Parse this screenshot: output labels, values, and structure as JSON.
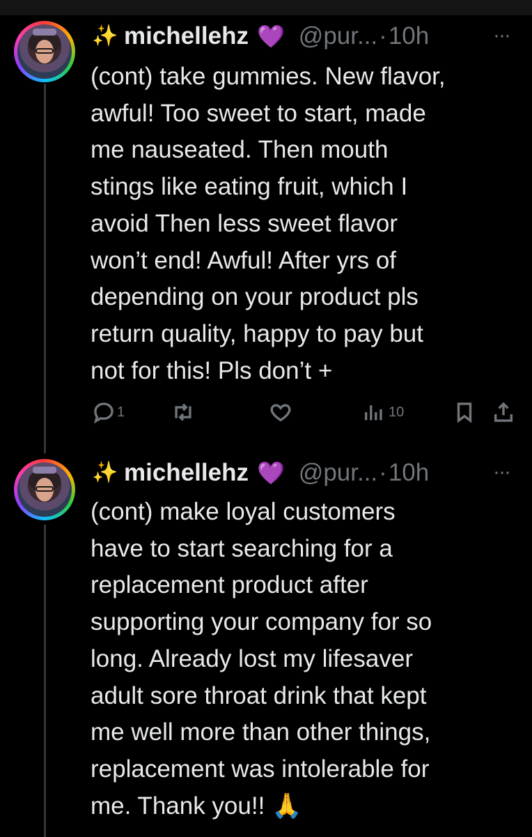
{
  "tweets": [
    {
      "emoji": "✨",
      "display_name": "michellehz",
      "heart": "💜",
      "handle": "@pur...",
      "separator": "·",
      "time": "10h",
      "more": "···",
      "text": "(cont) take gummies. New flavor,\nawful! Too sweet to start, made\nme nauseated. Then mouth\nstings like eating fruit, which I\navoid Then less sweet flavor\nwon’t end! Awful! After yrs of\ndepending on your product pls\nreturn quality, happy to pay but\nnot for this! Pls don’t +",
      "replies": "1",
      "views": "10"
    },
    {
      "emoji": "✨",
      "display_name": "michellehz",
      "heart": "💜",
      "handle": "@pur...",
      "separator": "·",
      "time": "10h",
      "more": "···",
      "text": "(cont) make loyal customers\nhave to start searching for a\nreplacement product after\nsupporting your company for so\nlong. Already lost my lifesaver\nadult sore throat drink that kept\nme well more than other things,\nreplacement was intolerable for\nme. Thank you!! 🙏"
    }
  ],
  "icons": {
    "reply": "reply-icon",
    "retweet": "retweet-icon",
    "like": "heart-icon",
    "views": "views-icon",
    "bookmark": "bookmark-icon",
    "share": "share-icon"
  },
  "colors": {
    "background": "#000000",
    "text": "#e7e9ea",
    "muted": "#71767b",
    "heart": "#9d4edd"
  }
}
